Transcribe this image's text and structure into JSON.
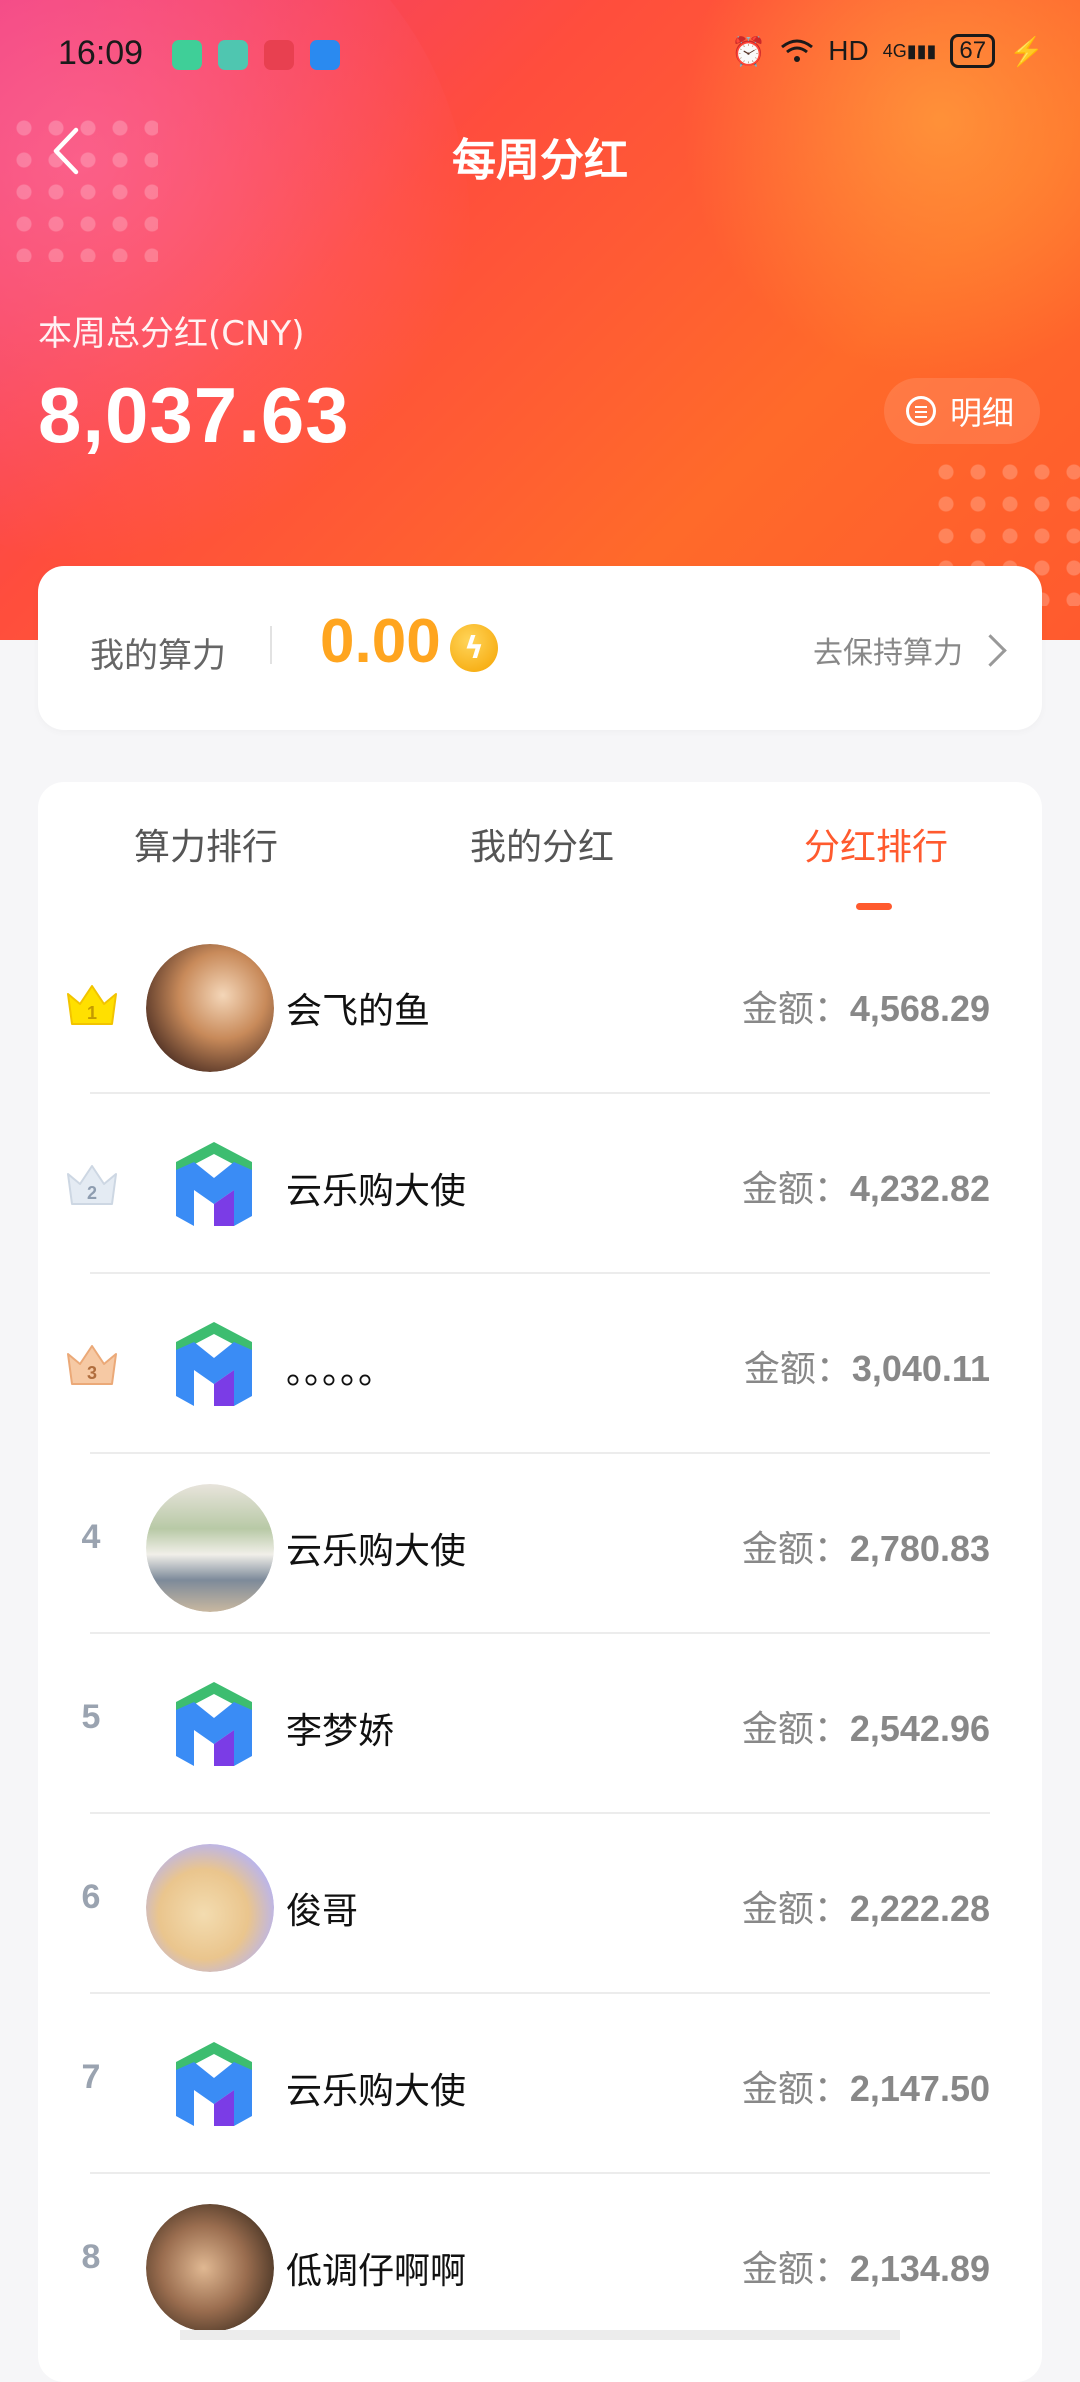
{
  "status_bar": {
    "time": "16:09",
    "network": "HD",
    "signal": "4G",
    "battery": "67"
  },
  "nav": {
    "title": "每周分红"
  },
  "summary": {
    "label": "本周总分红(CNY)",
    "value": "8,037.63",
    "detail_label": "明细"
  },
  "power": {
    "label": "我的算力",
    "value": "0.00",
    "action_label": "去保持算力"
  },
  "tabs": [
    {
      "label": "算力排行",
      "active": false
    },
    {
      "label": "我的分红",
      "active": false
    },
    {
      "label": "分红排行",
      "active": true
    }
  ],
  "amount_prefix": "金额：",
  "ranking": [
    {
      "rank": "1",
      "name": "会飞的鱼",
      "amount": "4,568.29",
      "avatar": "anime-girl"
    },
    {
      "rank": "2",
      "name": "云乐购大使",
      "amount": "4,232.82",
      "avatar": "app-logo"
    },
    {
      "rank": "3",
      "name": "。。。。。",
      "amount": "3,040.11",
      "avatar": "app-logo"
    },
    {
      "rank": "4",
      "name": "云乐购大使",
      "amount": "2,780.83",
      "avatar": "window-photo"
    },
    {
      "rank": "5",
      "name": "李梦娇",
      "amount": "2,542.96",
      "avatar": "app-logo"
    },
    {
      "rank": "6",
      "name": "俊哥",
      "amount": "2,222.28",
      "avatar": "cartoon-pig"
    },
    {
      "rank": "7",
      "name": "云乐购大使",
      "amount": "2,147.50",
      "avatar": "app-logo"
    },
    {
      "rank": "8",
      "name": "低调仔啊啊",
      "amount": "2,134.89",
      "avatar": "photo-couple"
    }
  ],
  "colors": {
    "accent": "#ff5a2e",
    "gold": "#ffa51f",
    "hero_start": "#f03a7a",
    "hero_end": "#ff6a2a"
  }
}
